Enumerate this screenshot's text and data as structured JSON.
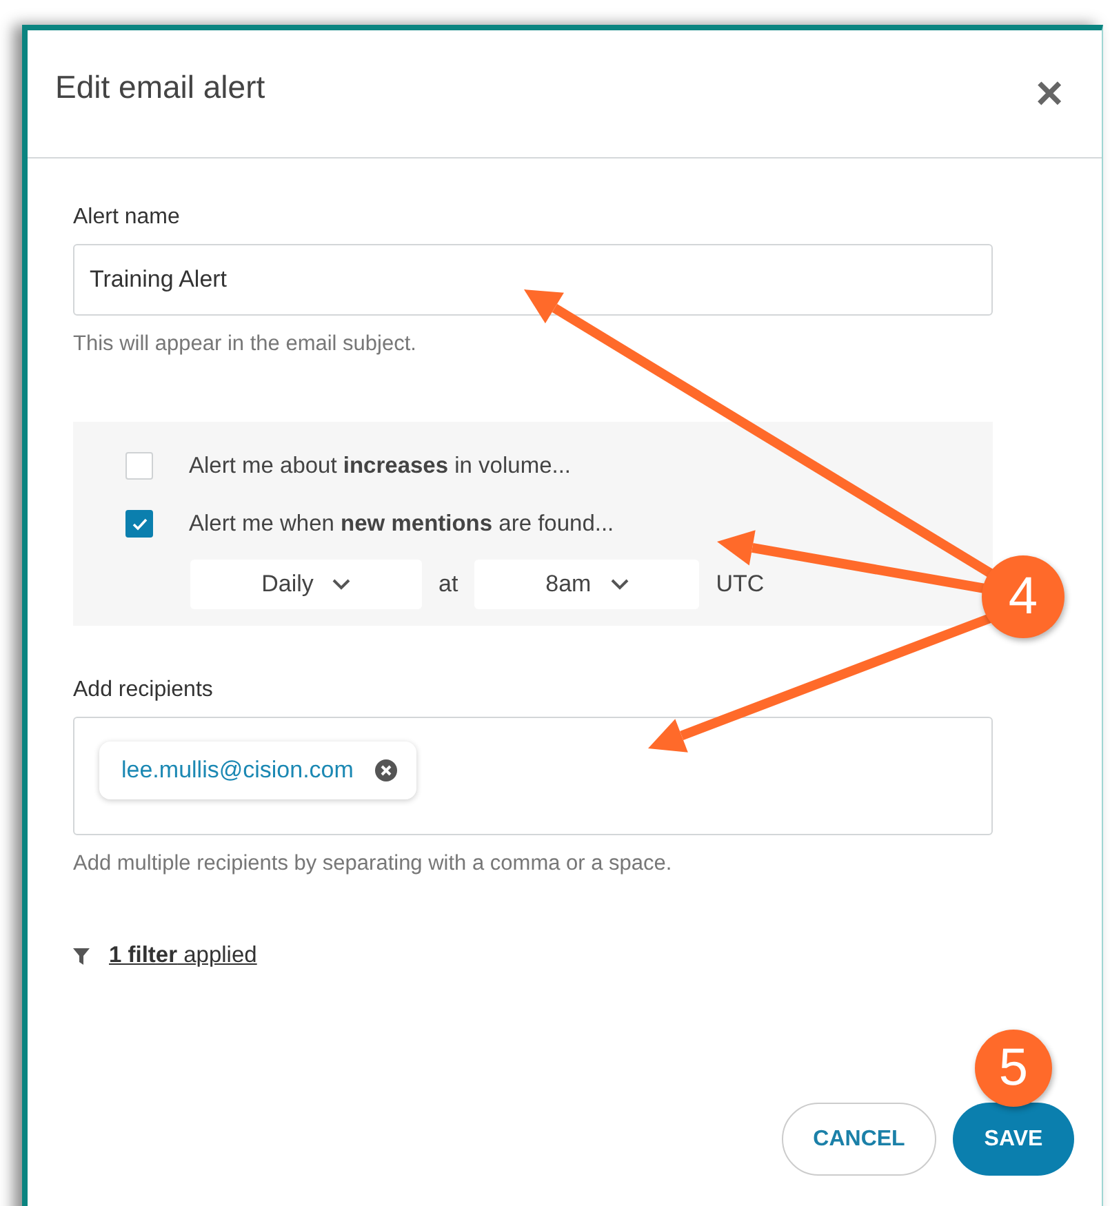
{
  "dialog": {
    "title": "Edit email alert",
    "close_label": "×"
  },
  "alert_name": {
    "label": "Alert name",
    "value": "Training Alert",
    "help": "This will appear in the email subject."
  },
  "options": [
    {
      "text": "Alert me about **increases** in volume...",
      "checked": false
    },
    {
      "text": "Alert me when **new mentions** are found...",
      "checked": true
    }
  ],
  "schedule": {
    "frequency": "Daily",
    "connector": "at",
    "time": "8am",
    "timezone": "UTC"
  },
  "recipients": {
    "label": "Add recipients",
    "chips": [
      "lee.mullis@cision.com"
    ],
    "help": "Add multiple recipients by separating with a comma or a space."
  },
  "filter_link": "**1 filter** applied",
  "buttons": [
    {
      "label": "CANCEL",
      "kind": "secondary"
    },
    {
      "label": "SAVE",
      "kind": "primary"
    }
  ],
  "annotations": [
    {
      "label": "4"
    },
    {
      "label": "5"
    }
  ]
}
